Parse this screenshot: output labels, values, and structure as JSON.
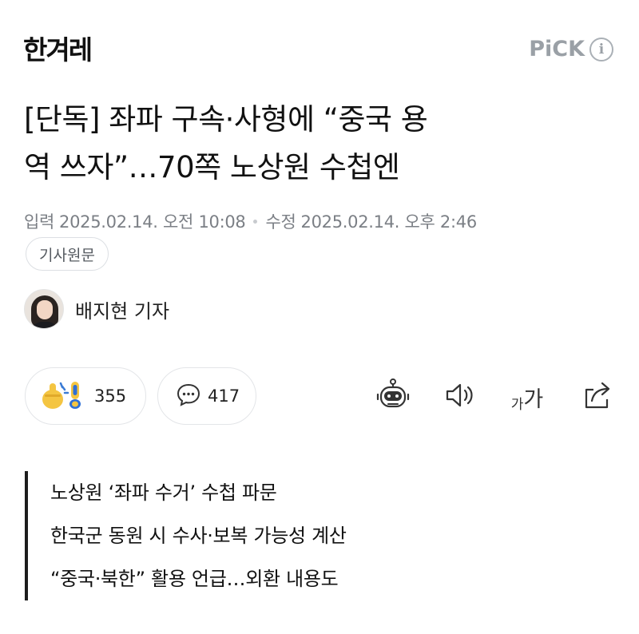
{
  "header": {
    "logo": "한겨레",
    "pick_label": "PiCK",
    "info_icon": "info-icon"
  },
  "article": {
    "headline_line1": "[단독] 좌파 구속·사형에 “중국 용",
    "headline_line2": "역 쓰자”…70쪽 노상원 수첩엔",
    "published_label": "입력",
    "published_at": "2025.02.14. 오전 10:08",
    "modified_label": "수정",
    "modified_at": "2025.02.14. 오후 2:46",
    "origin_button": "기사원문"
  },
  "author": {
    "name": "배지현 기자",
    "avatar_icon": "reporter-avatar"
  },
  "actions": {
    "reaction_count": "355",
    "comment_count": "417",
    "font_small": "가",
    "font_big": "가",
    "icons": [
      "reaction-emoji-icon",
      "comment-bubble-icon",
      "ai-robot-icon",
      "speaker-icon",
      "font-size-icon",
      "share-icon"
    ]
  },
  "summary": [
    "노상원 ‘좌파 수거’ 수첩 파문",
    "한국군 동원 시 수사·보복 가능성 계산",
    "“중국·북한” 활용 언급…외환 내용도"
  ],
  "colors": {
    "text": "#111111",
    "meta": "#7b7f85",
    "pick": "#9aa0a6",
    "border": "#e3e5e8",
    "summary_bar": "#1d1d1d"
  }
}
